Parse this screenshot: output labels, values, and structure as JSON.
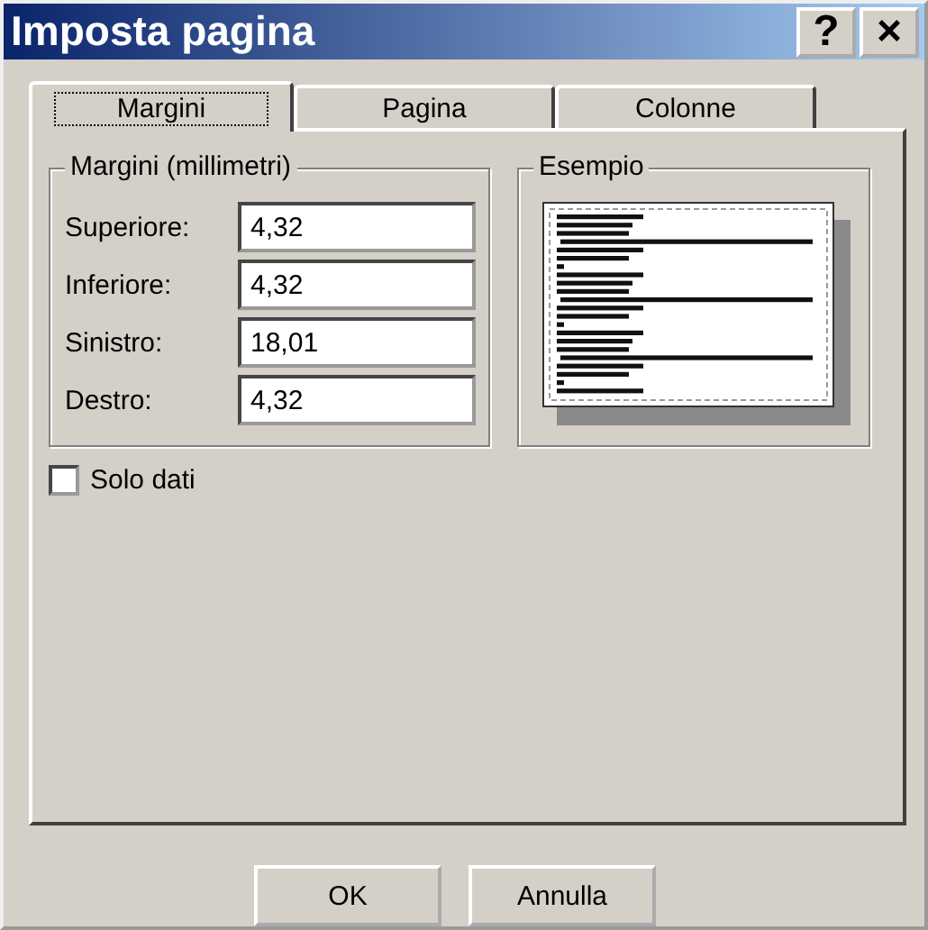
{
  "window": {
    "title": "Imposta pagina",
    "help": "?",
    "close": "×"
  },
  "tabs": [
    {
      "label": "Margini",
      "selected": true
    },
    {
      "label": "Pagina",
      "selected": false
    },
    {
      "label": "Colonne",
      "selected": false
    }
  ],
  "margins": {
    "title": "Margini (millimetri)",
    "fields": [
      {
        "label": "Superiore:",
        "value": "4,32"
      },
      {
        "label": "Inferiore:",
        "value": "4,32"
      },
      {
        "label": "Sinistro:",
        "value": "18,01"
      },
      {
        "label": "Destro:",
        "value": "4,32"
      }
    ]
  },
  "preview": {
    "title": "Esempio"
  },
  "solo_dati": {
    "label": "Solo dati",
    "checked": false
  },
  "buttons": [
    "OK",
    "Annulla"
  ]
}
